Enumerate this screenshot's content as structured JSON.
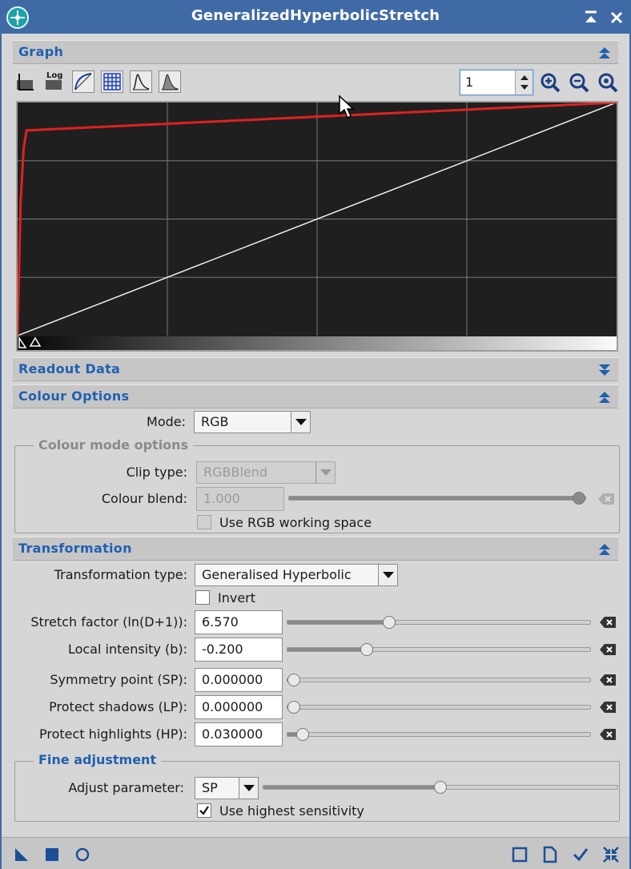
{
  "window": {
    "title": "GeneralizedHyperbolicStretch"
  },
  "sections": {
    "graph": "Graph",
    "readout": "Readout Data",
    "colour": "Colour Options",
    "transformation": "Transformation"
  },
  "graph": {
    "toolbar_icons": [
      "linear-scale-icon",
      "log-scale-icon",
      "transformation-curve-icon",
      "grid-icon",
      "histogram-before-icon",
      "histogram-after-icon"
    ],
    "log_label": "Log",
    "zoom_value": "1",
    "grid_cols": 4,
    "grid_rows": 4,
    "curve_color": "#e02020",
    "identity_color": "#f0f0f0"
  },
  "colour_options": {
    "mode_label": "Mode:",
    "mode_value": "RGB",
    "group_title": "Colour mode options",
    "clip_label": "Clip type:",
    "clip_value": "RGBBlend",
    "blend_label": "Colour blend:",
    "blend_value": "1.000",
    "blend_fraction": 1.0,
    "rgbws_label": "Use RGB working space",
    "rgbws_checked": false
  },
  "transformation": {
    "type_label": "Transformation type:",
    "type_value": "Generalised Hyperbolic",
    "invert_label": "Invert",
    "invert_checked": false,
    "params": [
      {
        "label": "Stretch factor (ln(D+1)):",
        "value": "6.570",
        "fraction": 0.33
      },
      {
        "label": "Local intensity (b):",
        "value": "-0.200",
        "fraction": 0.25
      },
      {
        "label": "Symmetry point (SP):",
        "value": "0.000000",
        "fraction": 0.0
      },
      {
        "label": "Protect shadows (LP):",
        "value": "0.000000",
        "fraction": 0.0
      },
      {
        "label": "Protect highlights (HP):",
        "value": "0.030000",
        "fraction": 0.03
      }
    ]
  },
  "fine_adjustment": {
    "title": "Fine adjustment",
    "param_label": "Adjust parameter:",
    "param_value": "SP",
    "slider_fraction": 0.5,
    "sensitivity_label": "Use highest sensitivity",
    "sensitivity_checked": true
  },
  "bottom": {
    "left_icons": [
      "new-instance-icon",
      "apply-global-icon",
      "real-time-preview-icon"
    ],
    "right_icons": [
      "browse-documentation-icon",
      "reset-icon",
      "ok-icon",
      "collapse-icon"
    ]
  },
  "colors": {
    "accent": "#2060b0",
    "titlebar": "#3f6aa6",
    "panel": "#d6d6d6"
  }
}
